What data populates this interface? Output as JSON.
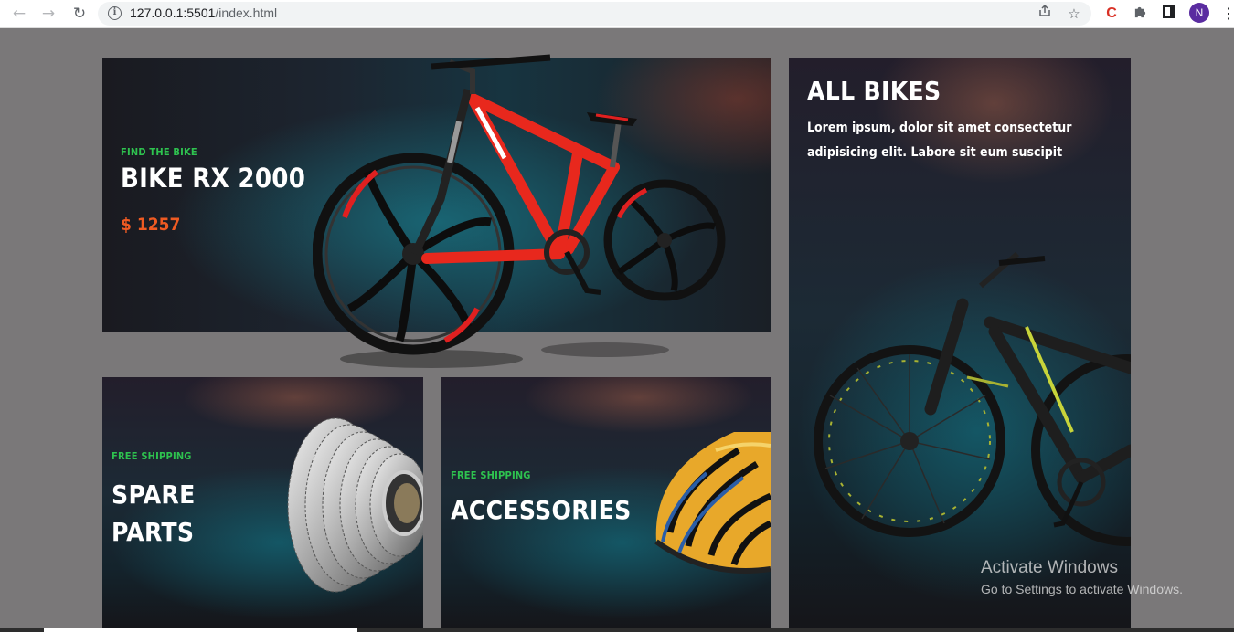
{
  "browser": {
    "url_host": "127.0.0.1:5501",
    "url_path": "/index.html",
    "profile_initial": "N",
    "icons": [
      "back-icon",
      "forward-icon",
      "reload-icon",
      "info-icon",
      "share-icon",
      "star-icon",
      "extension-c-icon",
      "puzzle-icon",
      "sidepanel-icon",
      "kebab-menu-icon"
    ]
  },
  "hero": {
    "eyebrow": "FIND THE BIKE",
    "title": "BIKE RX 2000",
    "price": "$ 1257"
  },
  "all_bikes": {
    "title": "ALL BIKES",
    "description": "Lorem ipsum, dolor sit amet consectetur adipisicing elit. Labore sit eum suscipit"
  },
  "spare_parts": {
    "eyebrow": "FREE SHIPPING",
    "title": "SPARE PARTS"
  },
  "accessories": {
    "eyebrow": "FREE SHIPPING",
    "title": "ACCESSORIES"
  },
  "watermark": {
    "title": "Activate Windows",
    "subtitle": "Go to Settings to activate Windows."
  },
  "colors": {
    "accent_green": "#2ec24f",
    "price_orange": "#ee5a22",
    "page_bg": "#7a7879"
  }
}
